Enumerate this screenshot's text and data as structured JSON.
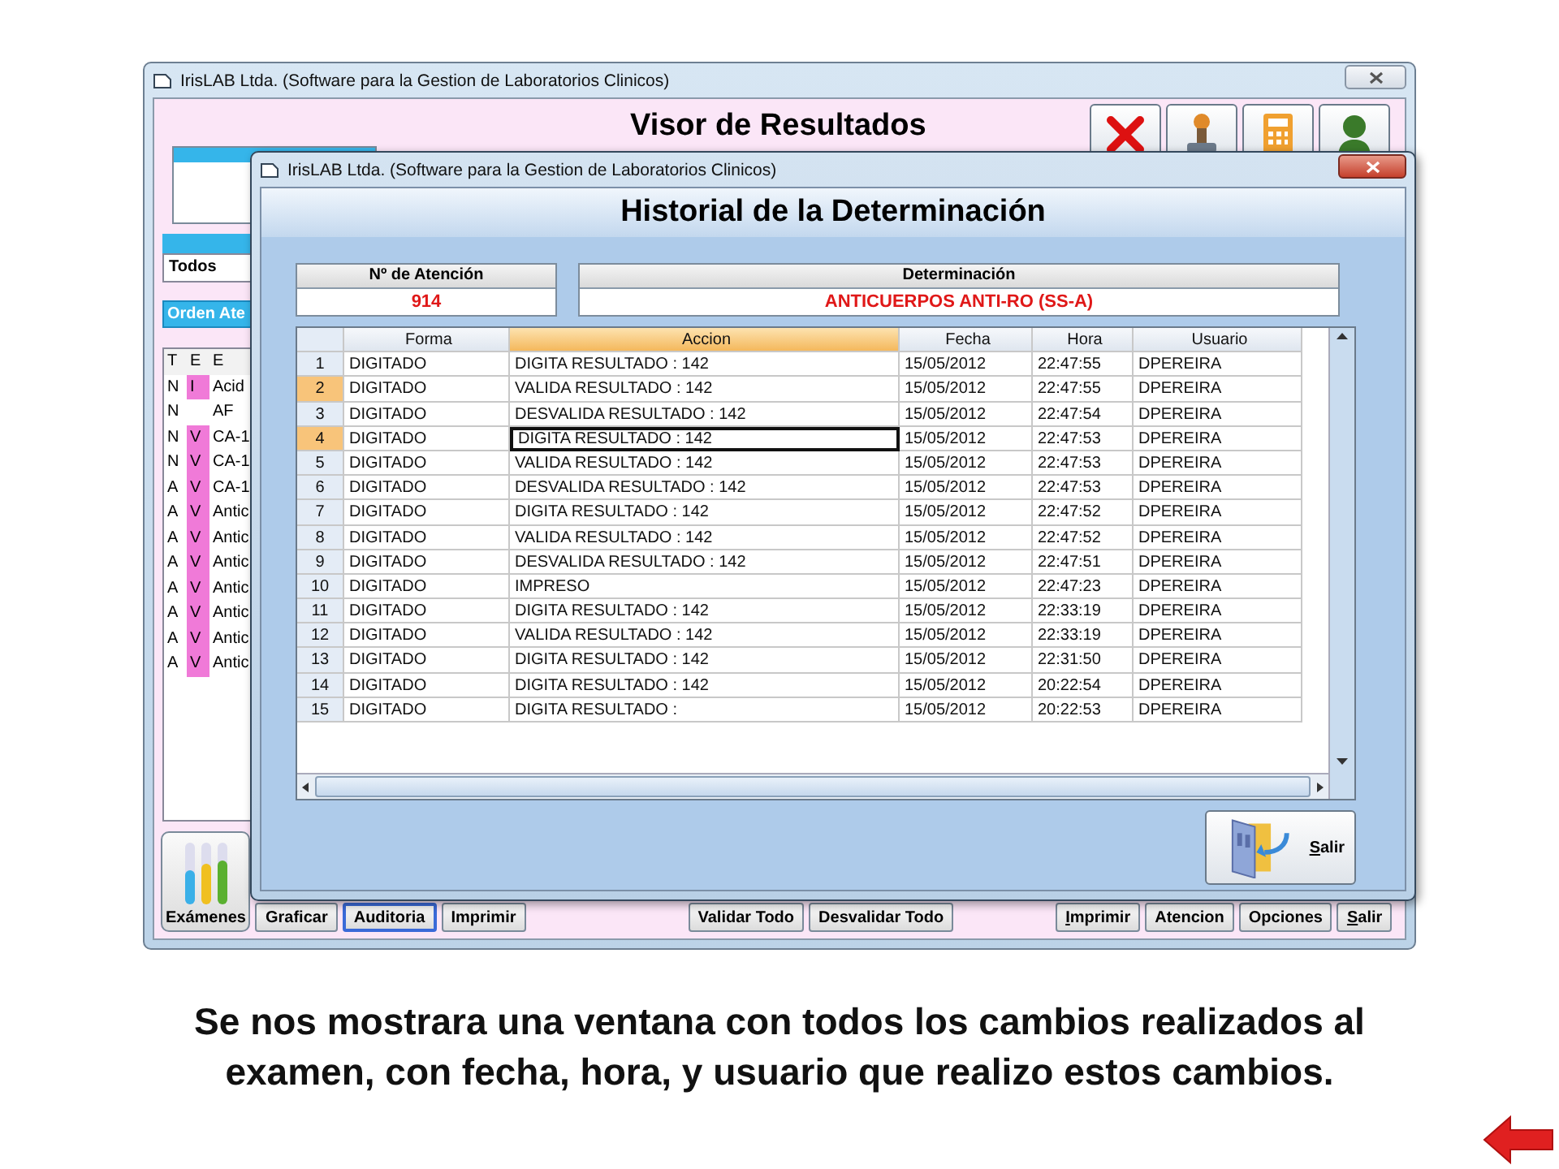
{
  "main_window": {
    "title": "IrisLAB Ltda. (Software para la Gestion de Laboratorios Clinicos)",
    "heading": "Visor de Resultados",
    "filter_field": {
      "value": "Todos"
    },
    "order_label": "Orden Ate",
    "exam_list": {
      "columns": [
        "T",
        "E",
        "E"
      ],
      "rows": [
        {
          "t": "N",
          "e": "I",
          "name": "Acid"
        },
        {
          "t": "N",
          "name": "AF"
        },
        {
          "t": "N",
          "e": "V",
          "name": "CA-1"
        },
        {
          "t": "N",
          "e": "V",
          "name": "CA-1"
        },
        {
          "t": "A",
          "e": "V",
          "name": "CA-1"
        },
        {
          "t": "A",
          "e": "V",
          "name": "Antic"
        },
        {
          "t": "A",
          "e": "V",
          "name": "Antic"
        },
        {
          "t": "A",
          "e": "V",
          "name": "Antic"
        },
        {
          "t": "A",
          "e": "V",
          "name": "Antic"
        },
        {
          "t": "A",
          "e": "V",
          "name": "Antic"
        },
        {
          "t": "A",
          "e": "V",
          "name": "Antic"
        },
        {
          "t": "A",
          "e": "V",
          "name": "Antic"
        }
      ]
    },
    "bottom_buttons": [
      {
        "label": "Exámenes",
        "kind": "large",
        "selected": false,
        "mnemonic": false
      },
      {
        "label": "Graficar",
        "kind": "small",
        "selected": false,
        "mnemonic": false
      },
      {
        "label": "Auditoria",
        "kind": "small",
        "selected": true,
        "mnemonic": false
      },
      {
        "label": "Imprimir",
        "kind": "small",
        "selected": false,
        "mnemonic": false
      },
      {
        "label": "Validar Todo",
        "kind": "small",
        "selected": false,
        "mnemonic": false
      },
      {
        "label": "Desvalidar Todo",
        "kind": "small",
        "selected": false,
        "mnemonic": false
      },
      {
        "label": "Imprimir",
        "kind": "small",
        "selected": false,
        "mnemonic": true
      },
      {
        "label": "Atencion",
        "kind": "small",
        "selected": false,
        "mnemonic": false
      },
      {
        "label": "Opciones",
        "kind": "small",
        "selected": false,
        "mnemonic": false
      },
      {
        "label": "Salir",
        "kind": "small",
        "selected": false,
        "mnemonic": true
      }
    ]
  },
  "dialog": {
    "title": "IrisLAB Ltda. (Software para la Gestion de Laboratorios Clinicos)",
    "heading": "Historial de la Determinación",
    "atencion": {
      "label": "Nº de Atención",
      "value": "914"
    },
    "determinacion": {
      "label": "Determinación",
      "value": "ANTICUERPOS ANTI-RO (SS-A)"
    },
    "table": {
      "columns": [
        {
          "label": "Forma",
          "selected": false
        },
        {
          "label": "Accion",
          "selected": true
        },
        {
          "label": "Fecha",
          "selected": false
        },
        {
          "label": "Hora",
          "selected": false
        },
        {
          "label": "Usuario",
          "selected": false
        }
      ],
      "rows": [
        {
          "number": "1",
          "selected": false,
          "focused": false,
          "cells": [
            "DIGITADO",
            "DIGITA RESULTADO : 142",
            "15/05/2012",
            "22:47:55",
            "DPEREIRA"
          ]
        },
        {
          "number": "2",
          "selected": true,
          "focused": false,
          "cells": [
            "DIGITADO",
            "VALIDA RESULTADO : 142",
            "15/05/2012",
            "22:47:55",
            "DPEREIRA"
          ]
        },
        {
          "number": "3",
          "selected": false,
          "focused": false,
          "cells": [
            "DIGITADO",
            "DESVALIDA RESULTADO : 142",
            "15/05/2012",
            "22:47:54",
            "DPEREIRA"
          ]
        },
        {
          "number": "4",
          "selected": true,
          "focused": true,
          "cells": [
            "DIGITADO",
            "DIGITA RESULTADO : 142",
            "15/05/2012",
            "22:47:53",
            "DPEREIRA"
          ]
        },
        {
          "number": "5",
          "selected": false,
          "focused": false,
          "cells": [
            "DIGITADO",
            "VALIDA RESULTADO : 142",
            "15/05/2012",
            "22:47:53",
            "DPEREIRA"
          ]
        },
        {
          "number": "6",
          "selected": false,
          "focused": false,
          "cells": [
            "DIGITADO",
            "DESVALIDA RESULTADO : 142",
            "15/05/2012",
            "22:47:53",
            "DPEREIRA"
          ]
        },
        {
          "number": "7",
          "selected": false,
          "focused": false,
          "cells": [
            "DIGITADO",
            "DIGITA RESULTADO : 142",
            "15/05/2012",
            "22:47:52",
            "DPEREIRA"
          ]
        },
        {
          "number": "8",
          "selected": false,
          "focused": false,
          "cells": [
            "DIGITADO",
            "VALIDA RESULTADO : 142",
            "15/05/2012",
            "22:47:52",
            "DPEREIRA"
          ]
        },
        {
          "number": "9",
          "selected": false,
          "focused": false,
          "cells": [
            "DIGITADO",
            "DESVALIDA RESULTADO : 142",
            "15/05/2012",
            "22:47:51",
            "DPEREIRA"
          ]
        },
        {
          "number": "10",
          "selected": false,
          "focused": false,
          "cells": [
            "DIGITADO",
            "IMPRESO",
            "15/05/2012",
            "22:47:23",
            "DPEREIRA"
          ]
        },
        {
          "number": "11",
          "selected": false,
          "focused": false,
          "cells": [
            "DIGITADO",
            "DIGITA RESULTADO : 142",
            "15/05/2012",
            "22:33:19",
            "DPEREIRA"
          ]
        },
        {
          "number": "12",
          "selected": false,
          "focused": false,
          "cells": [
            "DIGITADO",
            "VALIDA RESULTADO : 142",
            "15/05/2012",
            "22:33:19",
            "DPEREIRA"
          ]
        },
        {
          "number": "13",
          "selected": false,
          "focused": false,
          "cells": [
            "DIGITADO",
            "DIGITA RESULTADO : 142",
            "15/05/2012",
            "22:31:50",
            "DPEREIRA"
          ]
        },
        {
          "number": "14",
          "selected": false,
          "focused": false,
          "cells": [
            "DIGITADO",
            "DIGITA RESULTADO : 142",
            "15/05/2012",
            "20:22:54",
            "DPEREIRA"
          ]
        },
        {
          "number": "15",
          "selected": false,
          "focused": false,
          "cells": [
            "DIGITADO",
            "DIGITA RESULTADO :",
            "15/05/2012",
            "20:22:53",
            "DPEREIRA"
          ]
        }
      ]
    },
    "exit_button": {
      "label": "Salir",
      "mnemonic": true
    }
  },
  "caption": "Se nos mostrara una ventana con todos los cambios realizados al examen, con fecha, hora, y usuario que realizo estos cambios."
}
